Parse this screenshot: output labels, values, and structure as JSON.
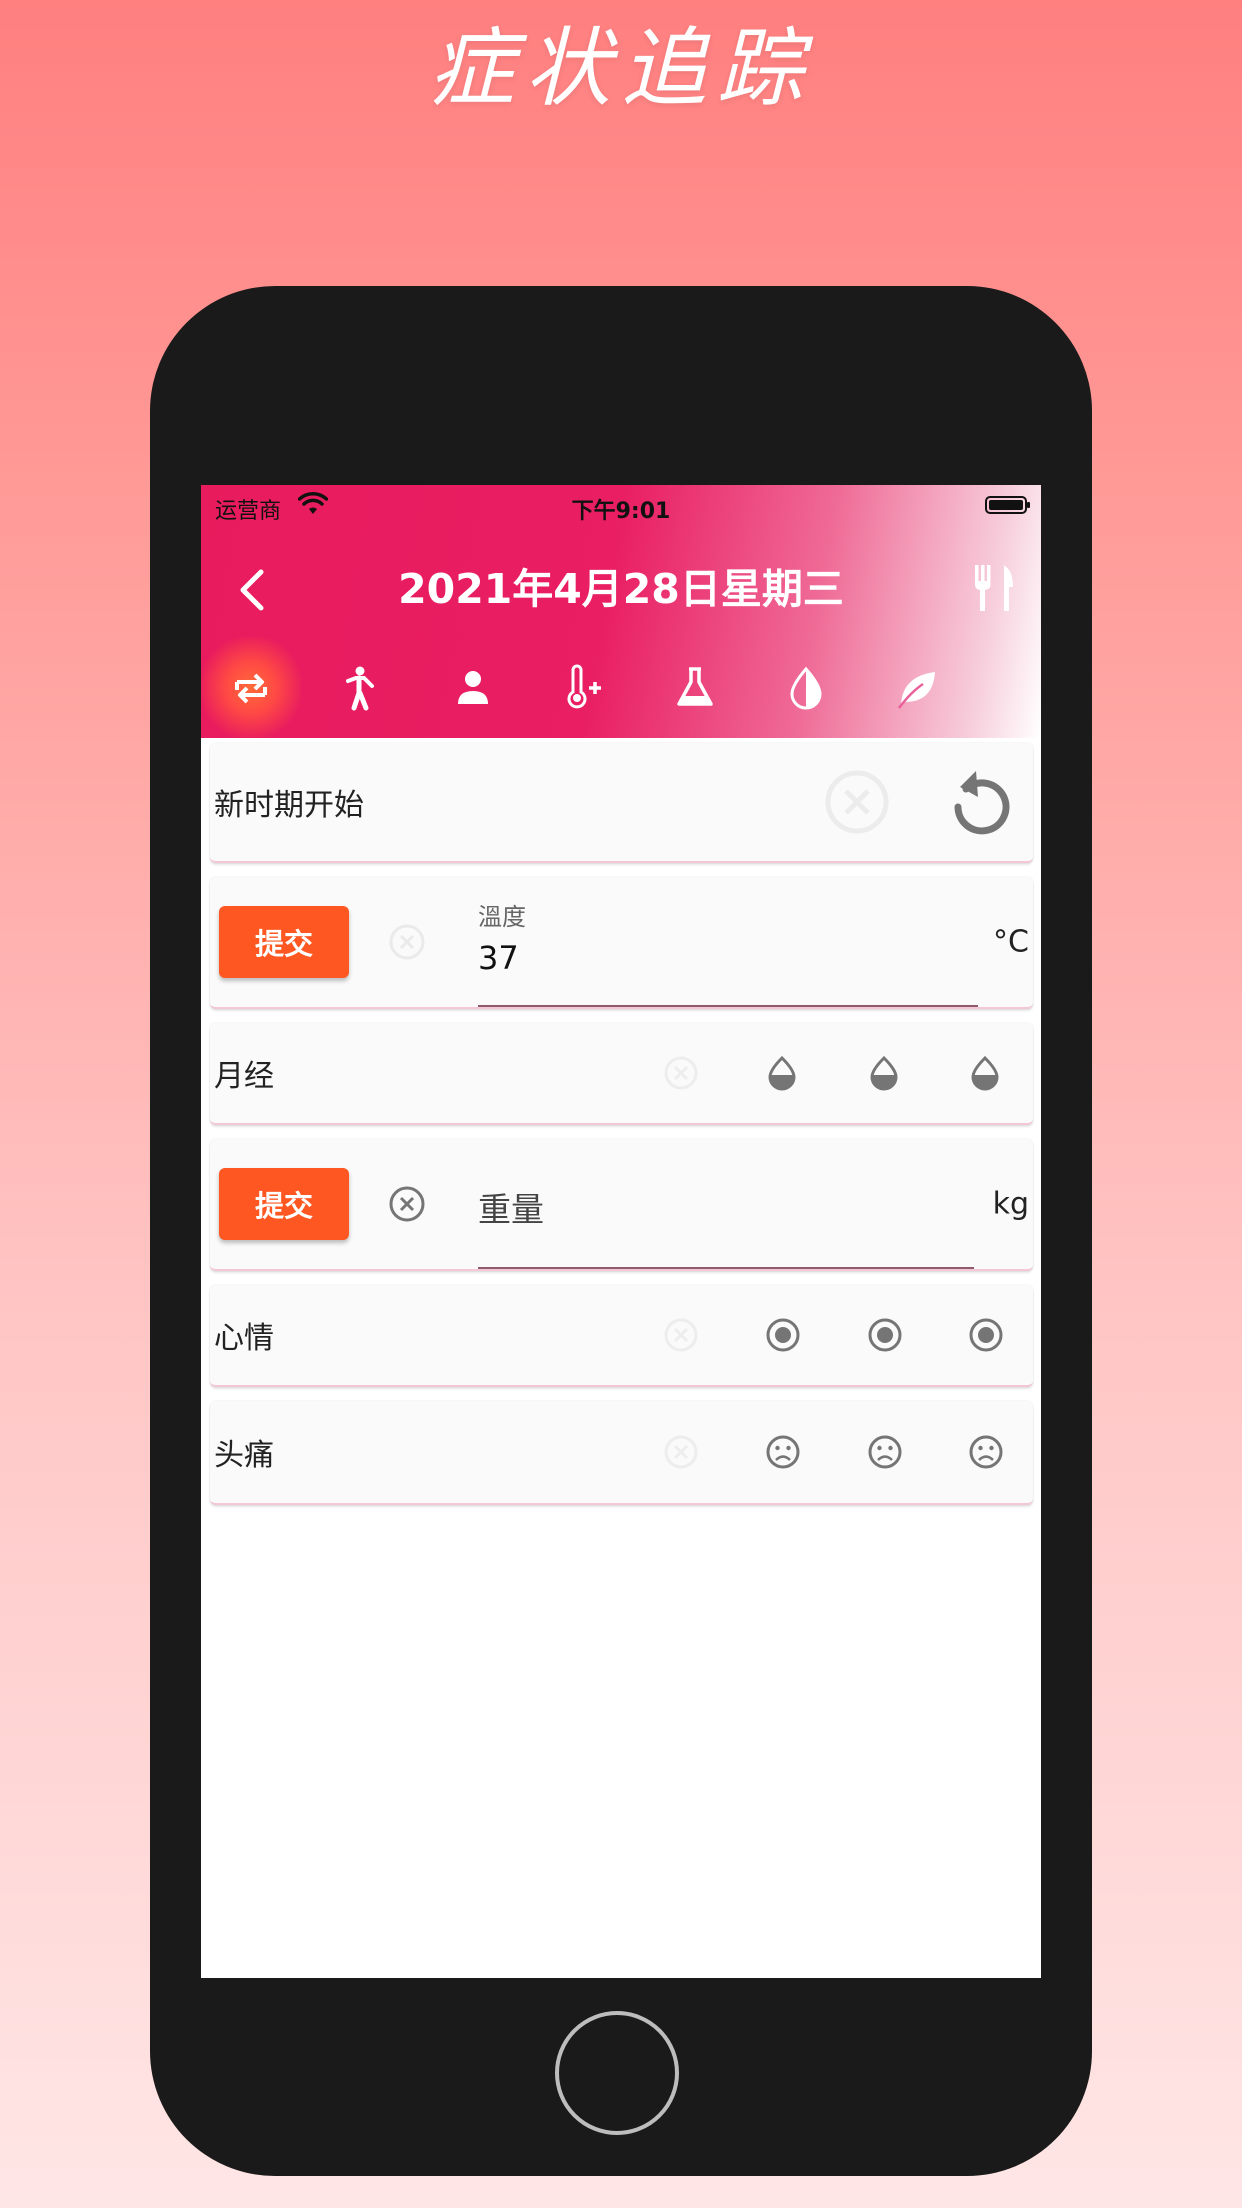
{
  "promo": {
    "title": "症状追踪"
  },
  "status_bar": {
    "carrier": "运营商",
    "time": "下午9:01"
  },
  "header": {
    "title": "2021年4月28日星期三"
  },
  "tabs": [
    {
      "icon": "swap-icon",
      "active": true
    },
    {
      "icon": "walking-person-icon",
      "active": false
    },
    {
      "icon": "person-icon",
      "active": false
    },
    {
      "icon": "thermometer-plus-icon",
      "active": false
    },
    {
      "icon": "flask-icon",
      "active": false
    },
    {
      "icon": "half-drop-icon",
      "active": false
    },
    {
      "icon": "leaf-icon",
      "active": false
    }
  ],
  "cards": {
    "new_period": {
      "label": "新时期开始"
    },
    "temperature": {
      "submit_label": "提交",
      "caption": "溫度",
      "value": "37",
      "unit": "°C"
    },
    "menstruation": {
      "label": "月经"
    },
    "weight": {
      "submit_label": "提交",
      "placeholder": "重量",
      "unit": "kg"
    },
    "mood": {
      "label": "心情"
    },
    "headache": {
      "label": "头痛"
    }
  },
  "colors": {
    "accent": "#e91e63",
    "button": "#ff5722",
    "icon_gray": "#757575"
  }
}
